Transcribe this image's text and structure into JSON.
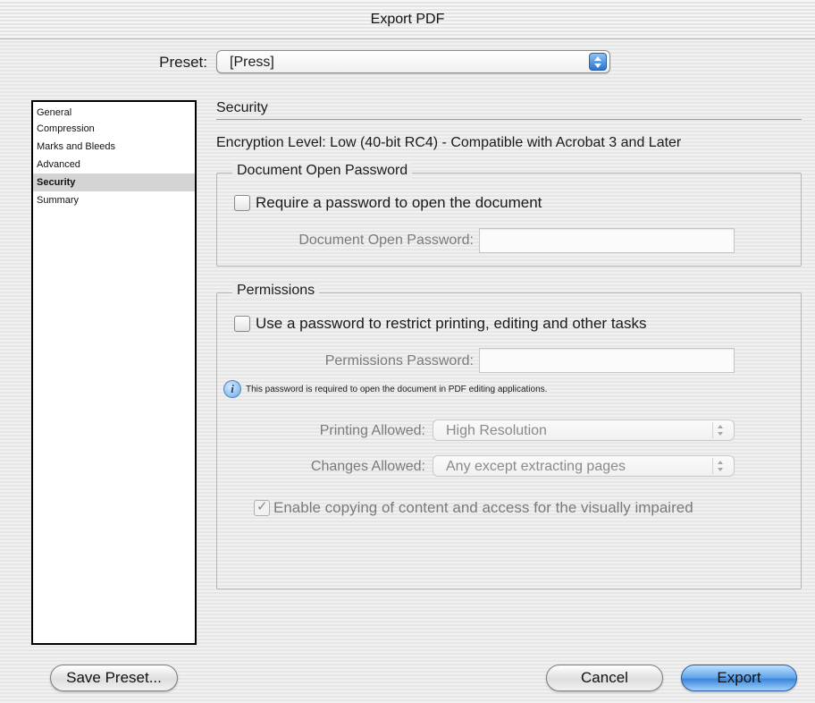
{
  "window": {
    "title": "Export PDF"
  },
  "preset": {
    "label": "Preset:",
    "value": "[Press]"
  },
  "sidebar": {
    "items": [
      {
        "label": "General",
        "selected": false
      },
      {
        "label": "Compression",
        "selected": false
      },
      {
        "label": "Marks and Bleeds",
        "selected": false
      },
      {
        "label": "Advanced",
        "selected": false
      },
      {
        "label": "Security",
        "selected": true
      },
      {
        "label": "Summary",
        "selected": false
      }
    ]
  },
  "main": {
    "section_title": "Security",
    "encryption_text": "Encryption Level: Low (40-bit RC4) - Compatible with Acrobat 3 and Later",
    "open_password_group": {
      "legend": "Document Open Password",
      "checkbox_label": "Require a password to open the document",
      "checkbox_checked": false,
      "field_label": "Document Open Password:",
      "field_value": ""
    },
    "permissions_group": {
      "legend": "Permissions",
      "checkbox_label": "Use a password to restrict printing, editing and other tasks",
      "checkbox_checked": false,
      "field_label": "Permissions Password:",
      "field_value": "",
      "info_icon": "info-icon",
      "info_text": "This password is required to open the document in PDF editing applications.",
      "printing_label": "Printing Allowed:",
      "printing_value": "High Resolution",
      "changes_label": "Changes Allowed:",
      "changes_value": "Any except extracting pages",
      "copy_checkbox_label": "Enable copying of content and access for the visually impaired",
      "copy_checkbox_checked": true,
      "copy_checkmark": "✓"
    }
  },
  "footer": {
    "save_preset_label": "Save Preset...",
    "cancel_label": "Cancel",
    "export_label": "Export"
  },
  "colors": {
    "accent_blue": "#3b86dc",
    "selected_sidebar_bg": "#d4d4d4"
  }
}
